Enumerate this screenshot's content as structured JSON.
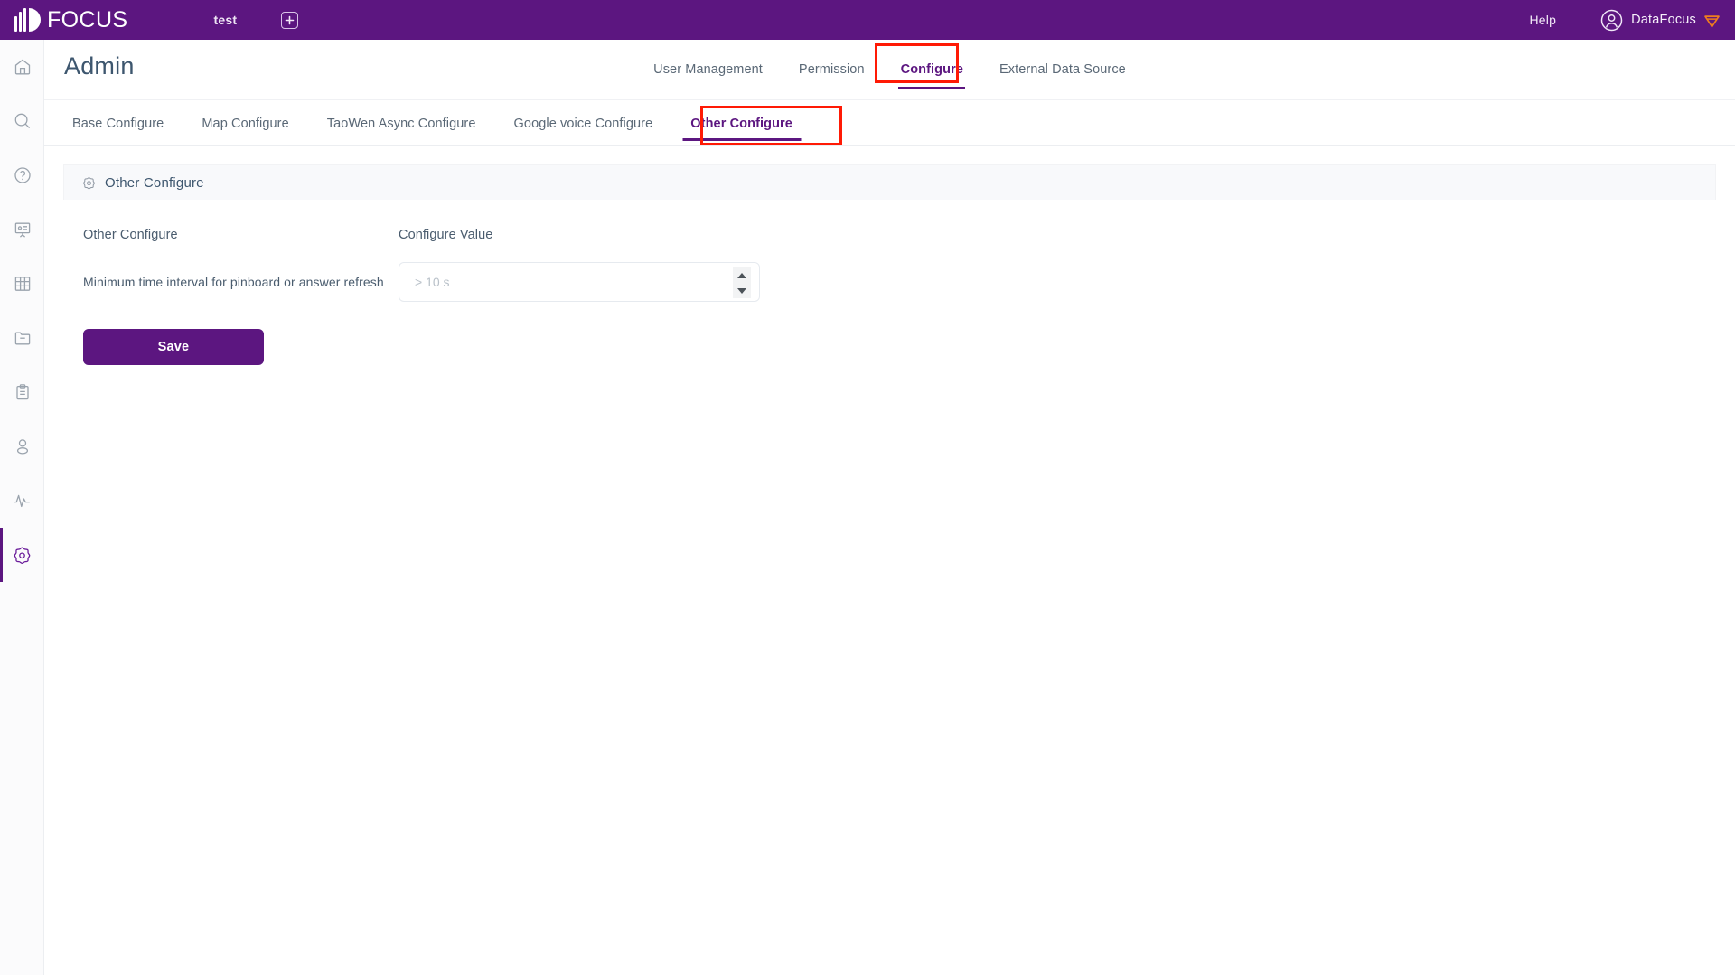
{
  "topbar": {
    "brand_name": "FOCUS",
    "brand_icon": "focus-logo-icon",
    "workspace_tab": "test",
    "add_tab_icon": "plus-square-icon",
    "help_label": "Help",
    "user_icon": "user-circle-icon",
    "user_name": "DataFocus",
    "gem_icon": "gem-icon",
    "bg_color": "#5C1680",
    "gem_color": "#F07D1E"
  },
  "sidebar": {
    "items": [
      {
        "name": "home-icon",
        "active": false
      },
      {
        "name": "search-icon",
        "active": false
      },
      {
        "name": "help-circle-icon",
        "active": false
      },
      {
        "name": "pinboard-icon",
        "active": false
      },
      {
        "name": "table-icon",
        "active": false
      },
      {
        "name": "folder-icon",
        "active": false
      },
      {
        "name": "clipboard-icon",
        "active": false
      },
      {
        "name": "user-icon",
        "active": false
      },
      {
        "name": "activity-icon",
        "active": false
      },
      {
        "name": "settings-gear-icon",
        "active": true
      }
    ],
    "active_color": "#5C1680"
  },
  "page": {
    "title": "Admin"
  },
  "main_nav": {
    "tabs": [
      {
        "label": "User Management",
        "active": false
      },
      {
        "label": "Permission",
        "active": false
      },
      {
        "label": "Configure",
        "active": true
      },
      {
        "label": "External Data Source",
        "active": false
      }
    ],
    "active_color": "#5C1680",
    "highlight_color": "#FF1A05"
  },
  "sub_nav": {
    "tabs": [
      {
        "label": "Base Configure",
        "active": false
      },
      {
        "label": "Map Configure",
        "active": false
      },
      {
        "label": "TaoWen Async Configure",
        "active": false
      },
      {
        "label": "Google voice Configure",
        "active": false
      },
      {
        "label": "Other Configure",
        "active": true
      }
    ]
  },
  "section": {
    "icon": "gear-icon",
    "title": "Other Configure"
  },
  "table": {
    "headers": {
      "col1": "Other Configure",
      "col2": "Configure Value"
    },
    "rows": [
      {
        "label": "Minimum time interval for pinboard or answer refresh",
        "value": "",
        "placeholder": "> 10 s"
      }
    ]
  },
  "actions": {
    "save_label": "Save",
    "save_color": "#5C1680"
  }
}
